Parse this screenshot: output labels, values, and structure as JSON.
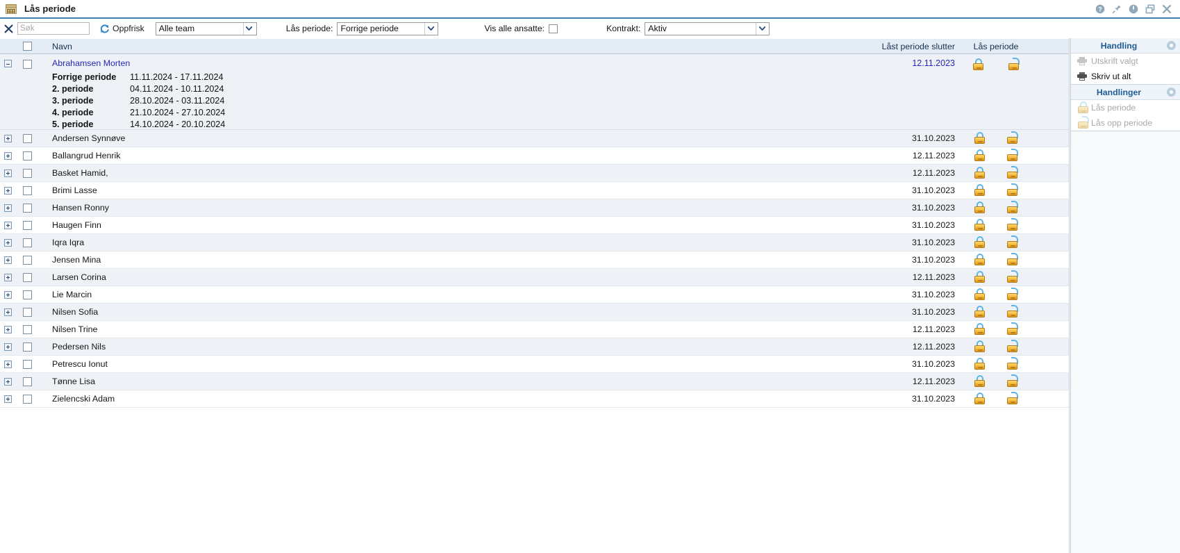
{
  "window": {
    "title": "Lås periode",
    "icon": "calendar-grid-icon",
    "controls": [
      {
        "name": "help-icon",
        "glyph": "?"
      },
      {
        "name": "pin-icon",
        "glyph": "pin"
      },
      {
        "name": "power-icon",
        "glyph": "power"
      },
      {
        "name": "restore-icon",
        "glyph": "restore"
      },
      {
        "name": "close-icon",
        "glyph": "close"
      }
    ]
  },
  "toolbar": {
    "clear_icon": "clear-x-icon",
    "search_value": "",
    "search_placeholder": "Søk",
    "refresh_icon": "refresh-icon",
    "refresh_label": "Oppfrisk",
    "team_value": "Alle team",
    "period_label": "Lås periode:",
    "period_value": "Forrige periode",
    "show_all_label": "Vis alle ansatte:",
    "show_all_checked": false,
    "contract_label": "Kontrakt:",
    "contract_value": "Aktiv"
  },
  "grid": {
    "columns": {
      "name": "Navn",
      "locked_period_end": "Låst periode slutter",
      "lock_period": "Lås periode"
    },
    "expanded_row": {
      "name": "Abrahamsen Morten",
      "date": "12.11.2023",
      "periods": [
        {
          "label": "Forrige periode",
          "range": "11.11.2024 - 17.11.2024"
        },
        {
          "label": "2. periode",
          "range": "04.11.2024 - 10.11.2024"
        },
        {
          "label": "3. periode",
          "range": "28.10.2024 - 03.11.2024"
        },
        {
          "label": "4. periode",
          "range": "21.10.2024 - 27.10.2024"
        },
        {
          "label": "5. periode",
          "range": "14.10.2024 - 20.10.2024"
        }
      ]
    },
    "rows": [
      {
        "name": "Andersen Synnøve",
        "date": "31.10.2023"
      },
      {
        "name": "Ballangrud Henrik",
        "date": "12.11.2023"
      },
      {
        "name": "Basket Hamid,",
        "date": "12.11.2023"
      },
      {
        "name": "Brimi Lasse",
        "date": "31.10.2023"
      },
      {
        "name": "Hansen Ronny",
        "date": "31.10.2023"
      },
      {
        "name": "Haugen Finn",
        "date": "31.10.2023"
      },
      {
        "name": "Iqra Iqra",
        "date": "31.10.2023"
      },
      {
        "name": "Jensen Mina",
        "date": "31.10.2023"
      },
      {
        "name": "Larsen Corina",
        "date": "12.11.2023"
      },
      {
        "name": "Lie Marcin",
        "date": "31.10.2023"
      },
      {
        "name": "Nilsen Sofia",
        "date": "31.10.2023"
      },
      {
        "name": "Nilsen Trine",
        "date": "12.11.2023"
      },
      {
        "name": "Pedersen Nils",
        "date": "12.11.2023"
      },
      {
        "name": "Petrescu Ionut",
        "date": "31.10.2023"
      },
      {
        "name": "Tønne Lisa",
        "date": "12.11.2023"
      },
      {
        "name": "Zielencski Adam",
        "date": "31.10.2023"
      }
    ]
  },
  "side": {
    "section1_title": "Handling",
    "section1_items": [
      {
        "label": "Utskrift valgt",
        "icon": "printer-icon",
        "disabled": true
      },
      {
        "label": "Skriv ut alt",
        "icon": "printer-icon",
        "disabled": false
      }
    ],
    "section2_title": "Handlinger",
    "section2_items": [
      {
        "label": "Lås periode",
        "icon": "lock-closed-icon",
        "disabled": true
      },
      {
        "label": "Lås opp periode",
        "icon": "lock-open-icon",
        "disabled": true
      }
    ]
  },
  "colors": {
    "accent": "#3c7fb1",
    "header_bg": "#e3ecf4",
    "link": "#2727b8",
    "side_title": "#1f5b96",
    "lock_gold": "#f6bd3c",
    "lock_shackle": "#5fb4e6"
  }
}
